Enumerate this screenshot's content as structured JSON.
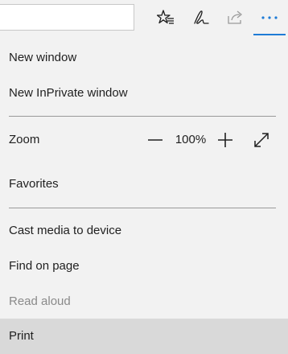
{
  "toolbar": {
    "address_value": "",
    "favorite_icon": "star-add-icon",
    "notes_icon": "pen-icon",
    "share_icon": "share-icon",
    "more_icon": "more-icon",
    "accent_color": "#1e7bd6"
  },
  "menu": {
    "new_window": "New window",
    "new_inprivate_window": "New InPrivate window",
    "zoom_label": "Zoom",
    "zoom_value": "100%",
    "favorites": "Favorites",
    "cast_media": "Cast media to device",
    "find_on_page": "Find on page",
    "read_aloud": "Read aloud",
    "print": "Print"
  }
}
